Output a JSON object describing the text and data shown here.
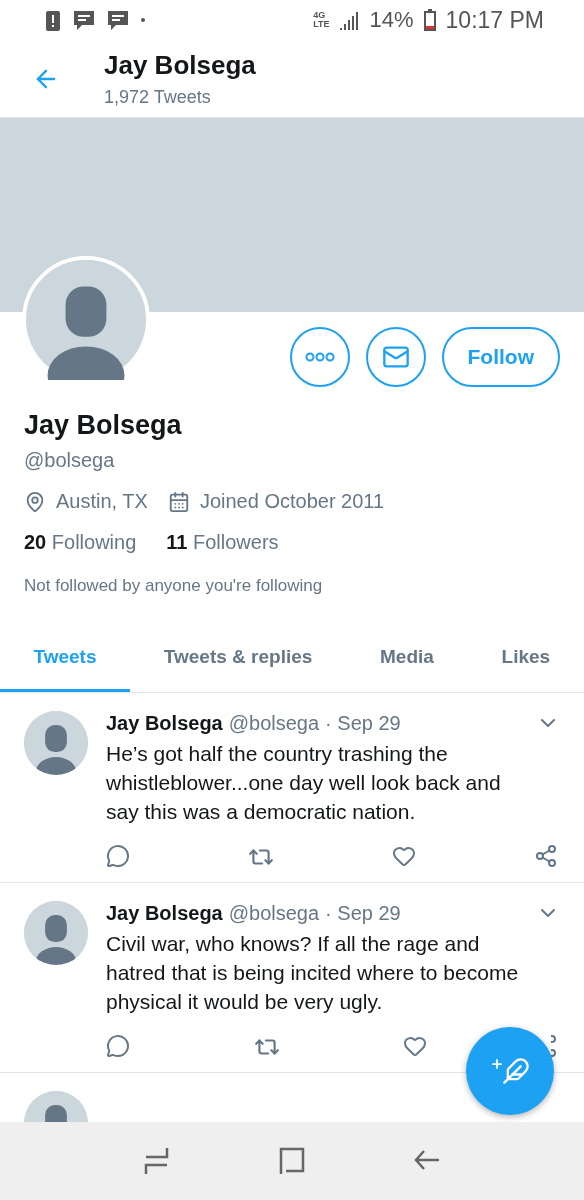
{
  "status_bar": {
    "network": [
      "4G",
      "LTE"
    ],
    "battery": "14%",
    "time": "10:17 PM"
  },
  "header": {
    "title": "Jay Bolsega",
    "subtitle": "1,972 Tweets"
  },
  "profile": {
    "follow_button": "Follow",
    "name": "Jay Bolsega",
    "handle": "@bolsega",
    "location": "Austin, TX",
    "joined": "Joined October 2011",
    "stats": [
      {
        "count": "20",
        "label": "Following"
      },
      {
        "count": "11",
        "label": "Followers"
      }
    ],
    "note": "Not followed by anyone you're following"
  },
  "tabs": [
    {
      "label": "Tweets",
      "selected": true
    },
    {
      "label": "Tweets & replies",
      "selected": false
    },
    {
      "label": "Media",
      "selected": false
    },
    {
      "label": "Likes",
      "selected": false
    }
  ],
  "tweets": [
    {
      "name": "Jay Bolsega",
      "handle": "@bolsega",
      "date": "· Sep 29",
      "text": "He’s got half the country trashing the whistleblower...one day well look back and say this was a democratic nation."
    },
    {
      "name": "Jay Bolsega",
      "handle": "@bolsega",
      "date": "· Sep 29",
      "text": "Civil war, who knows?  If all the rage and hatred that is being incited where to become physical it would be very ugly."
    }
  ]
}
